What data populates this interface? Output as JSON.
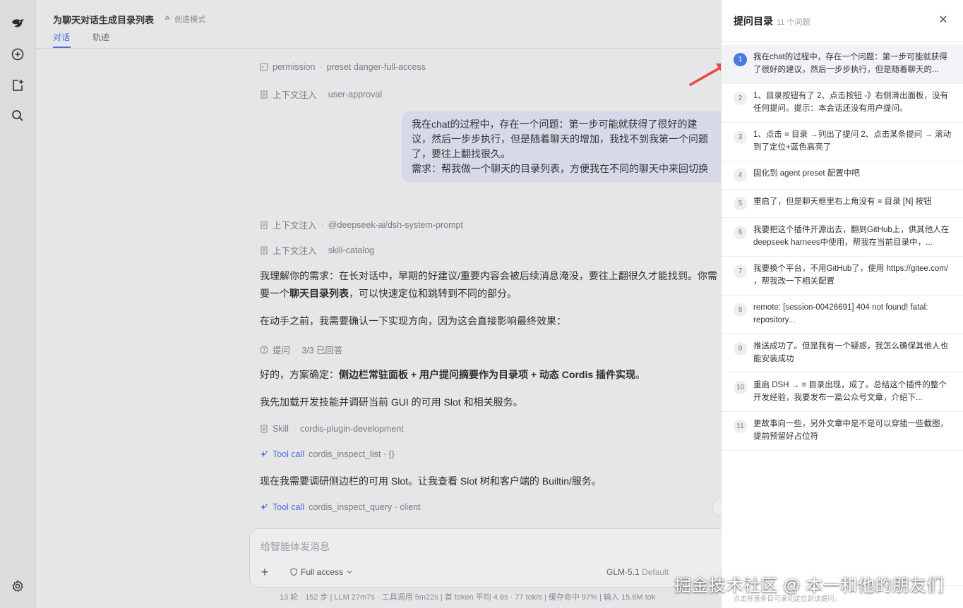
{
  "header": {
    "title": "为聊天对话生成目录列表",
    "mode": "创造模式",
    "tabs": [
      "对话",
      "轨迹"
    ]
  },
  "messages": {
    "meta1": {
      "kind": "permission",
      "detail": "preset danger-full-access"
    },
    "meta2": {
      "kind": "上下文注入",
      "detail": "user-approval"
    },
    "user_bubble": [
      "我在chat的过程中，存在一个问题：第一步可能就获得了很好的建",
      "议，然后一步步执行，但是随着聊天的增加，我找不到我第一个问题",
      "了，要往上翻找很久。",
      "需求：帮我做一个聊天的目录列表，方便我在不同的聊天中来回切换"
    ],
    "meta3": {
      "kind": "上下文注入",
      "detail": "@deepseek-ai/dsh-system-prompt"
    },
    "meta4": {
      "kind": "上下文注入",
      "detail": "skill-catalog"
    },
    "p1_line1": "我理解你的需求：在长对话中，早期的好建议/重要内容会被后续消息淹没，要往上翻很久才能找到。你需",
    "p1_line2_pre": "要一个",
    "p1_line2_bold": "聊天目录列表",
    "p1_line2_post": "，可以快速定位和跳转到不同的部分。",
    "p2": "在动手之前，我需要确认一下实现方向，因为这会直接影响最终效果：",
    "meta5": {
      "kind": "提问",
      "detail": "3/3 已回答"
    },
    "p3_pre": "好的，方案确定：",
    "p3_bold": "侧边栏常驻面板 + 用户提问摘要作为目录项 + 动态 Cordis 插件实现",
    "p3_post": "。",
    "p4": "我先加载开发技能并调研当前 GUI 的可用 Slot 和相关服务。",
    "meta6": {
      "kind": "Skill",
      "detail": "cordis-plugin-development"
    },
    "tool1": {
      "kind": "Tool call",
      "detail": "cordis_inspect_list · {}"
    },
    "p5": "现在我需要调研侧边栏的可用 Slot。让我查看 Slot 树和客户端的 Builtin/服务。",
    "tool2": {
      "kind": "Tool call",
      "detail": "cordis_inspect_query · client"
    }
  },
  "composer": {
    "placeholder": "给智能体发消息",
    "access": "Full access",
    "model": "GLM-5.1",
    "model_default": "Default"
  },
  "statusbar": "13 轮 · 152 步  |  LLM 27m7s · 工具调用 5m22s  |  首 token 平均 4.6s · 77 tok/s  |  缓存命中 97%  |  输入 15.6M tok",
  "drawer": {
    "title": "提问目录",
    "count": "11 个问题",
    "footer": "点击任意条目可滚动定位到该提问。",
    "items": [
      {
        "n": "1",
        "text": "我在chat的过程中，存在一个问题：第一步可能就获得了很好的建议，然后一步步执行，但是随着聊天的..."
      },
      {
        "n": "2",
        "text": "1、目录按钮有了 2、点击按钮 -》右侧滑出面板，没有任何提问。提示：本会话还没有用户提问。"
      },
      {
        "n": "3",
        "text": "1、点击 ≡ 目录 →列出了提问 2、点击某条提问 → 滚动到了定位+蓝色高亮了"
      },
      {
        "n": "4",
        "text": "固化到 agent preset 配置中吧"
      },
      {
        "n": "5",
        "text": "重启了，但是聊天框里右上角没有 ≡ 目录 [N] 按钮"
      },
      {
        "n": "6",
        "text": "我要把这个插件开源出去，翻到GitHub上，供其他人在deepseek harnees中使用，帮我在当前目录中，..."
      },
      {
        "n": "7",
        "text": "我要换个平台，不用GitHub了，使用 https://gitee.com/ ，帮我改一下相关配置"
      },
      {
        "n": "8",
        "text": "remote: [session-00426691] 404 not found! fatal: repository..."
      },
      {
        "n": "9",
        "text": "推送成功了。但是我有一个疑惑，我怎么确保其他人也能安装成功"
      },
      {
        "n": "10",
        "text": "重启 DSH → ≡ 目录出现，成了。总结这个插件的整个开发经验，我要发布一篇公众号文章，介绍下..."
      },
      {
        "n": "11",
        "text": "更故事向一些，另外文章中是不是可以穿插一些截图，提前预留好占位符"
      }
    ]
  },
  "watermark": "掘金技术社区 @ 本一和他的朋友们",
  "colors": {
    "accent": "#4a7ae0",
    "annotation_arrow": "#e8453c"
  }
}
